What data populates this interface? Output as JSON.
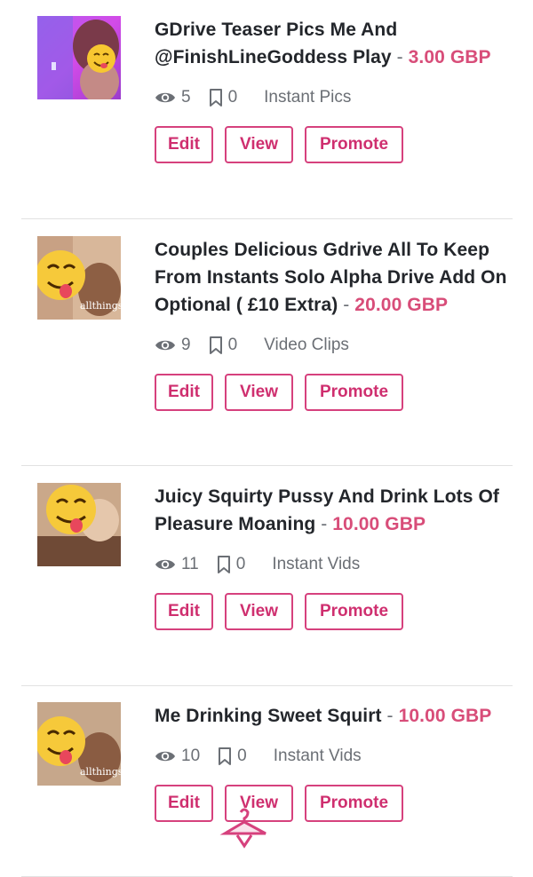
{
  "listings": [
    {
      "title": "GDrive Teaser Pics Me And @FinishLineGoddess Play",
      "price": "3.00 GBP",
      "views": "5",
      "saves": "0",
      "category": "Instant Pics"
    },
    {
      "title": "Couples Delicious Gdrive All To Keep From Instants Solo Alpha Drive Add On Optional ( £10 Extra)",
      "price": "20.00 GBP",
      "views": "9",
      "saves": "0",
      "category": "Video Clips",
      "thumb_watermark": "allthings"
    },
    {
      "title": "Juicy Squirty Pussy And Drink Lots Of Pleasure Moaning",
      "price": "10.00 GBP",
      "views": "11",
      "saves": "0",
      "category": "Instant Vids"
    },
    {
      "title": "Me Drinking Sweet Squirt",
      "price": "10.00 GBP",
      "views": "10",
      "saves": "0",
      "category": "Instant Vids",
      "thumb_watermark": "allthings"
    }
  ],
  "actions": {
    "edit_label": "Edit",
    "view_label": "View",
    "promote_label": "Promote"
  },
  "price_separator": "-",
  "overlay_watermark": "Promote",
  "icons": {
    "views": "eye-icon",
    "saves": "bookmark-icon",
    "thumb_emoji": "face-savoring-food-emoji"
  },
  "colors": {
    "accent": "#d6417d",
    "price": "#d84d79",
    "title": "#23262b",
    "muted": "#6b6f75"
  }
}
